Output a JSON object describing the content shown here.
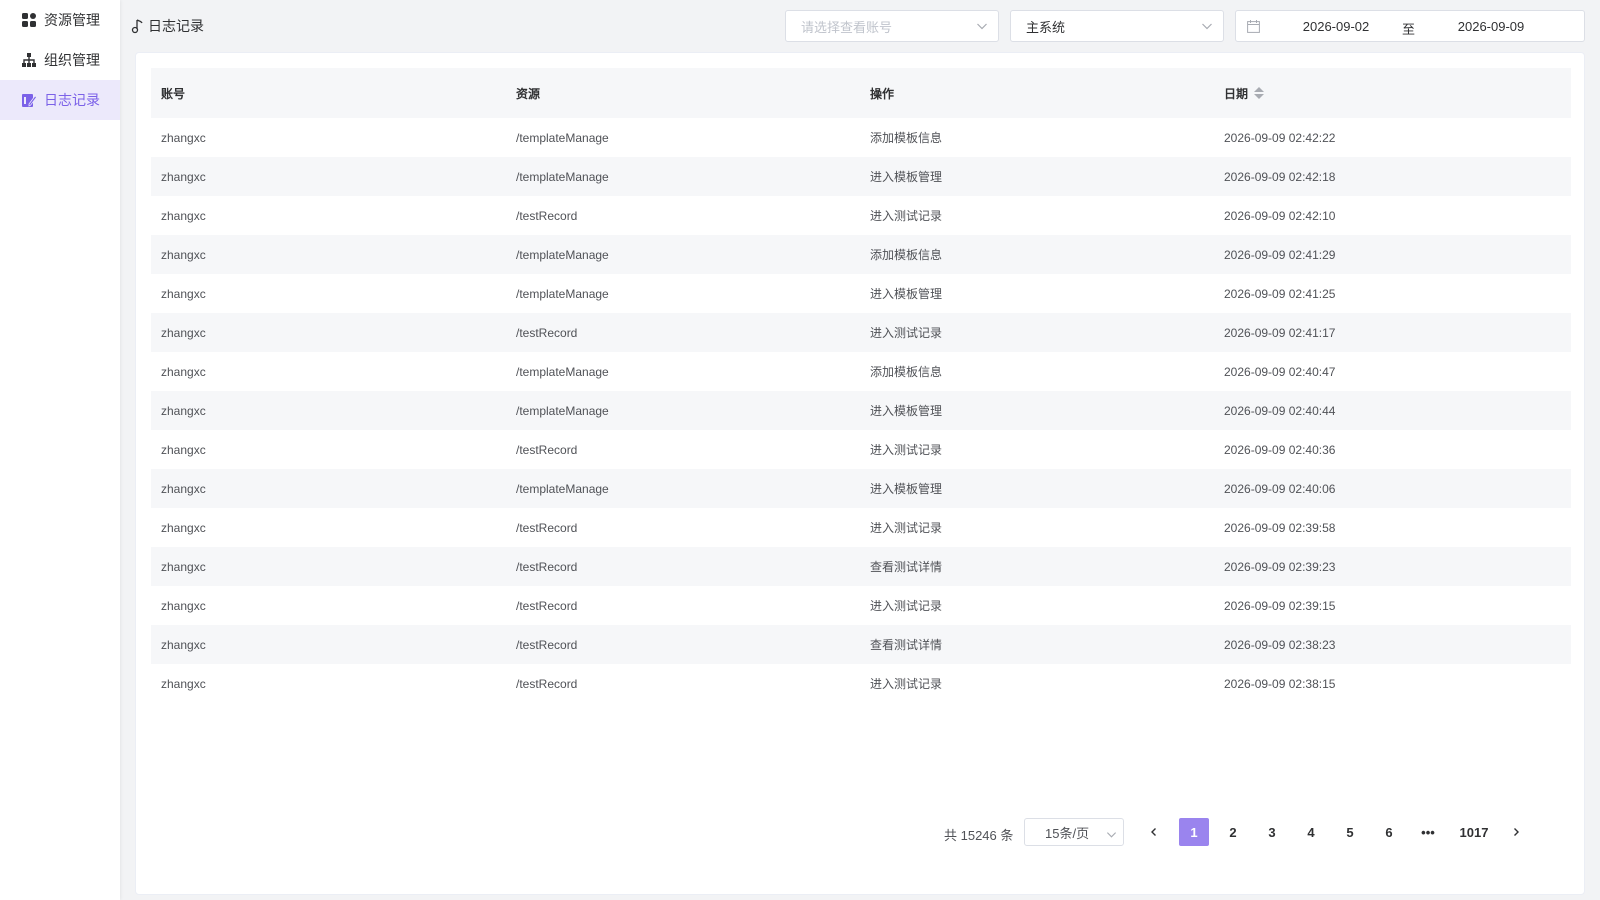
{
  "sidebar": {
    "items": [
      {
        "label": "资源管理",
        "icon": "grid-icon"
      },
      {
        "label": "组织管理",
        "icon": "org-tree-icon"
      },
      {
        "label": "日志记录",
        "icon": "log-edit-icon"
      }
    ],
    "active_index": 2,
    "accent_color": "#7b61e8"
  },
  "header": {
    "breadcrumb": "日志记录",
    "account_select_placeholder": "请选择查看账号",
    "system_select_value": "主系统",
    "date_start": "2026-09-02",
    "date_sep": "至",
    "date_end": "2026-09-09"
  },
  "table": {
    "columns": [
      "账号",
      "资源",
      "操作",
      "日期"
    ],
    "rows": [
      [
        "zhangxc",
        "/templateManage",
        "添加模板信息",
        "2026-09-09 02:42:22"
      ],
      [
        "zhangxc",
        "/templateManage",
        "进入模板管理",
        "2026-09-09 02:42:18"
      ],
      [
        "zhangxc",
        "/testRecord",
        "进入测试记录",
        "2026-09-09 02:42:10"
      ],
      [
        "zhangxc",
        "/templateManage",
        "添加模板信息",
        "2026-09-09 02:41:29"
      ],
      [
        "zhangxc",
        "/templateManage",
        "进入模板管理",
        "2026-09-09 02:41:25"
      ],
      [
        "zhangxc",
        "/testRecord",
        "进入测试记录",
        "2026-09-09 02:41:17"
      ],
      [
        "zhangxc",
        "/templateManage",
        "添加模板信息",
        "2026-09-09 02:40:47"
      ],
      [
        "zhangxc",
        "/templateManage",
        "进入模板管理",
        "2026-09-09 02:40:44"
      ],
      [
        "zhangxc",
        "/testRecord",
        "进入测试记录",
        "2026-09-09 02:40:36"
      ],
      [
        "zhangxc",
        "/templateManage",
        "进入模板管理",
        "2026-09-09 02:40:06"
      ],
      [
        "zhangxc",
        "/testRecord",
        "进入测试记录",
        "2026-09-09 02:39:58"
      ],
      [
        "zhangxc",
        "/testRecord",
        "查看测试详情",
        "2026-09-09 02:39:23"
      ],
      [
        "zhangxc",
        "/testRecord",
        "进入测试记录",
        "2026-09-09 02:39:15"
      ],
      [
        "zhangxc",
        "/testRecord",
        "查看测试详情",
        "2026-09-09 02:38:23"
      ],
      [
        "zhangxc",
        "/testRecord",
        "进入测试记录",
        "2026-09-09 02:38:15"
      ]
    ]
  },
  "pagination": {
    "total_text": "共 15246 条",
    "page_size": "15条/页",
    "pages": [
      "1",
      "2",
      "3",
      "4",
      "5",
      "6",
      "•••",
      "1017"
    ],
    "current": "1",
    "prev_icon": "chevron-left-icon",
    "next_icon": "chevron-right-icon",
    "active_color": "#9a84ee"
  }
}
